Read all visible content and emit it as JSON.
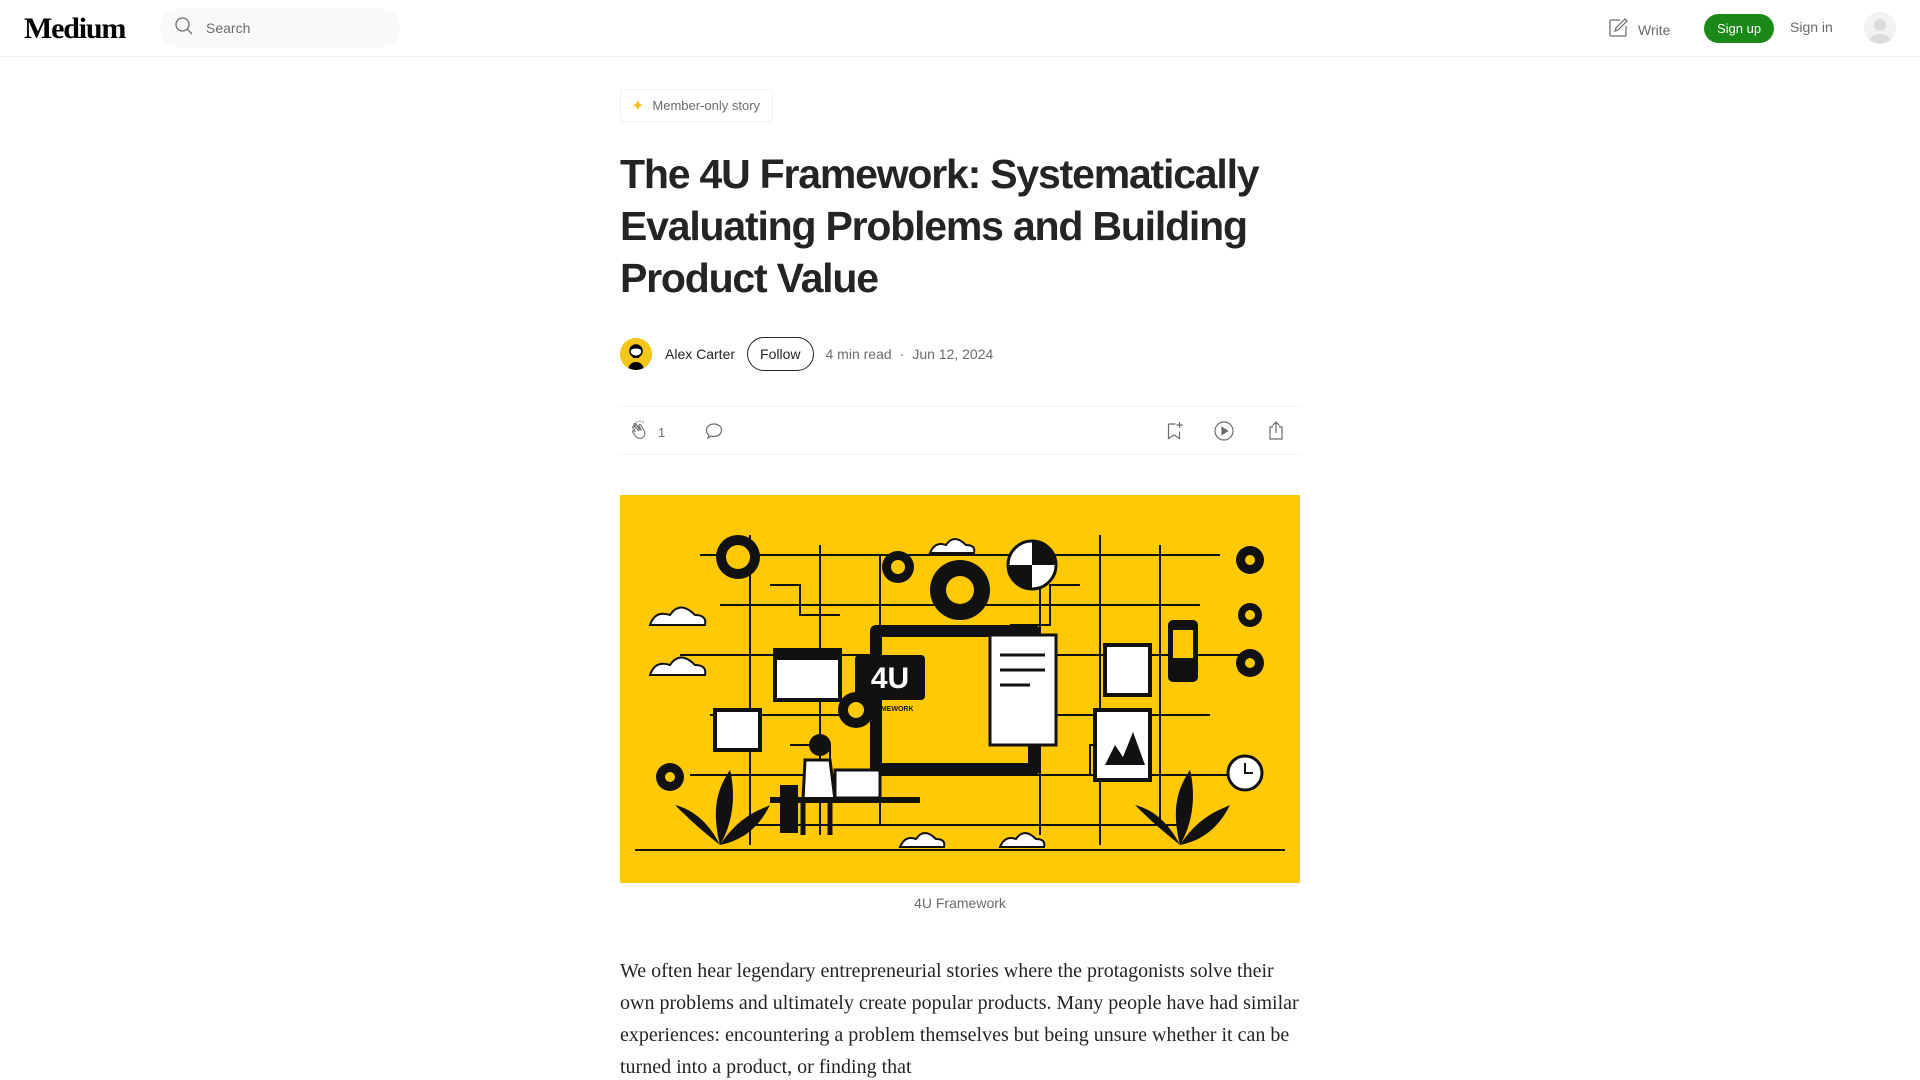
{
  "nav": {
    "logo": "Medium",
    "search_placeholder": "Search",
    "write_label": "Write",
    "signup_label": "Sign up",
    "signin_label": "Sign in"
  },
  "article": {
    "member_badge": "Member-only story",
    "title": "The 4U Framework: Systematically Evaluating Problems and Building Product Value",
    "author": "Alex Carter",
    "follow_label": "Follow",
    "read_time": "4 min read",
    "date": "Jun 12, 2024",
    "claps": "1",
    "image_caption": "4U Framework",
    "image_text": "4U",
    "image_subtext": "FRAMEWORK",
    "body": "We often hear legendary entrepreneurial stories where the protagonists solve their own problems and ultimately create popular products. Many people have had similar experiences: encountering a problem themselves but being unsure whether it can be turned into a product, or finding that"
  },
  "icons": [
    "search-icon",
    "write-icon",
    "avatar-icon",
    "sparkle-icon",
    "clap-icon",
    "comment-icon",
    "bookmark-icon",
    "listen-icon",
    "share-icon"
  ],
  "colors": {
    "accent_green": "#1a8917",
    "hero_yellow": "#ffc906",
    "member_star": "#ffc017",
    "text": "#242424",
    "muted": "#6b6b6b"
  }
}
